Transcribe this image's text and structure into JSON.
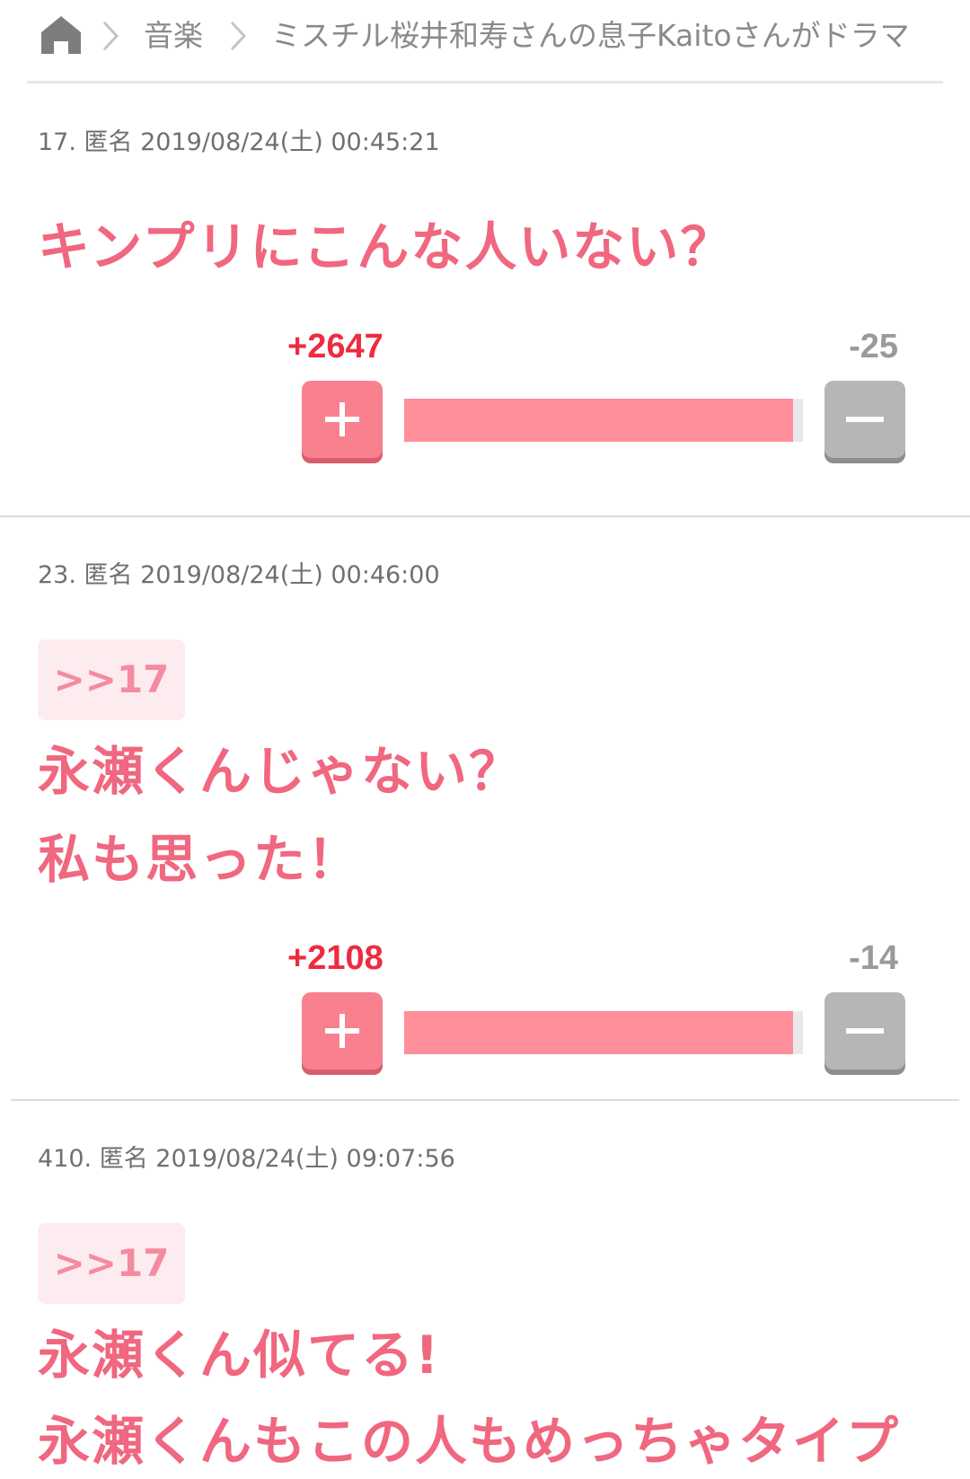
{
  "breadcrumb": {
    "home_icon": "home-icon",
    "separator_icon": "chevron-right-icon",
    "category": "音楽",
    "title": "ミスチル桜井和寿さんの息子Kaitoさんがドラマ"
  },
  "comments": [
    {
      "meta": "17. 匿名 2019/08/24(土) 00:45:21",
      "anchor": "",
      "lines": [
        "キンプリにこんな人いない？"
      ],
      "plus_count": "+2647",
      "minus_count": "-25",
      "plus_ratio": 0.975
    },
    {
      "meta": "23. 匿名 2019/08/24(土) 00:46:00",
      "anchor": ">>17",
      "lines": [
        "永瀬くんじゃない？",
        "私も思った！"
      ],
      "plus_count": "+2108",
      "minus_count": "-14",
      "plus_ratio": 0.975
    },
    {
      "meta": "410. 匿名 2019/08/24(土) 09:07:56",
      "anchor": ">>17",
      "lines": [
        "永瀬くん似てる!",
        "永瀬くんもこの人もめっちゃタイプ"
      ]
    }
  ],
  "colors": {
    "accent_pink": "#f0677f",
    "plus_red": "#ee2b40",
    "bar_fill": "#ff8e9b"
  }
}
